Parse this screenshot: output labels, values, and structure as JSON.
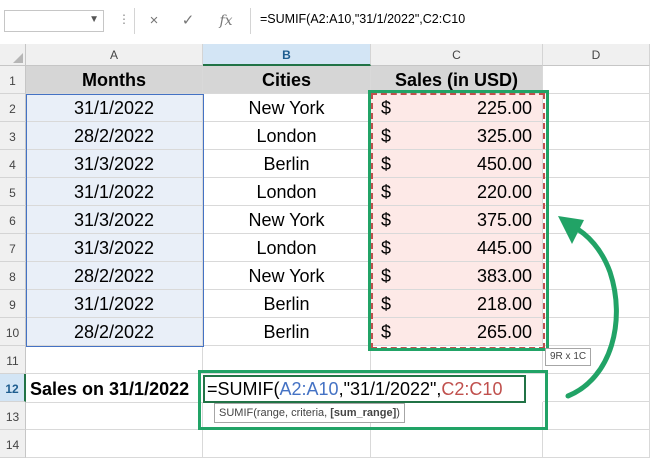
{
  "formula_bar": {
    "name_box_value": "",
    "cancel_icon": "×",
    "enter_icon": "✓",
    "fx_label": "fx",
    "formula": "=SUMIF(A2:A10,\"31/1/2022\",C2:C10"
  },
  "columns": [
    "A",
    "B",
    "C",
    "D"
  ],
  "rows": [
    "1",
    "2",
    "3",
    "4",
    "5",
    "6",
    "7",
    "8",
    "9",
    "10",
    "11",
    "12",
    "13",
    "14"
  ],
  "headers": {
    "months": "Months",
    "cities": "Cities",
    "sales": "Sales (in USD)"
  },
  "data": [
    {
      "month": "31/1/2022",
      "city": "New York",
      "currency": "$",
      "amount": "225.00"
    },
    {
      "month": "28/2/2022",
      "city": "London",
      "currency": "$",
      "amount": "325.00"
    },
    {
      "month": "31/3/2022",
      "city": "Berlin",
      "currency": "$",
      "amount": "450.00"
    },
    {
      "month": "31/1/2022",
      "city": "London",
      "currency": "$",
      "amount": "220.00"
    },
    {
      "month": "31/3/2022",
      "city": "New York",
      "currency": "$",
      "amount": "375.00"
    },
    {
      "month": "31/3/2022",
      "city": "London",
      "currency": "$",
      "amount": "445.00"
    },
    {
      "month": "28/2/2022",
      "city": "New York",
      "currency": "$",
      "amount": "383.00"
    },
    {
      "month": "31/1/2022",
      "city": "Berlin",
      "currency": "$",
      "amount": "218.00"
    },
    {
      "month": "28/2/2022",
      "city": "Berlin",
      "currency": "$",
      "amount": "265.00"
    }
  ],
  "row12": {
    "label": "Sales on 31/1/2022",
    "edit_parts": {
      "prefix": "=SUMIF(",
      "range1": "A2:A10",
      "mid": ",\"31/1/2022\",",
      "range2": "C2:C10"
    },
    "tooltip": {
      "fn": "SUMIF(range, criteria, ",
      "bold_arg": "[sum_range]",
      "close": ")"
    }
  },
  "size_tip": "9R x 1C",
  "colors": {
    "accent_green": "#21a366",
    "range_blue": "#4472c4",
    "range_red": "#c0504d"
  }
}
